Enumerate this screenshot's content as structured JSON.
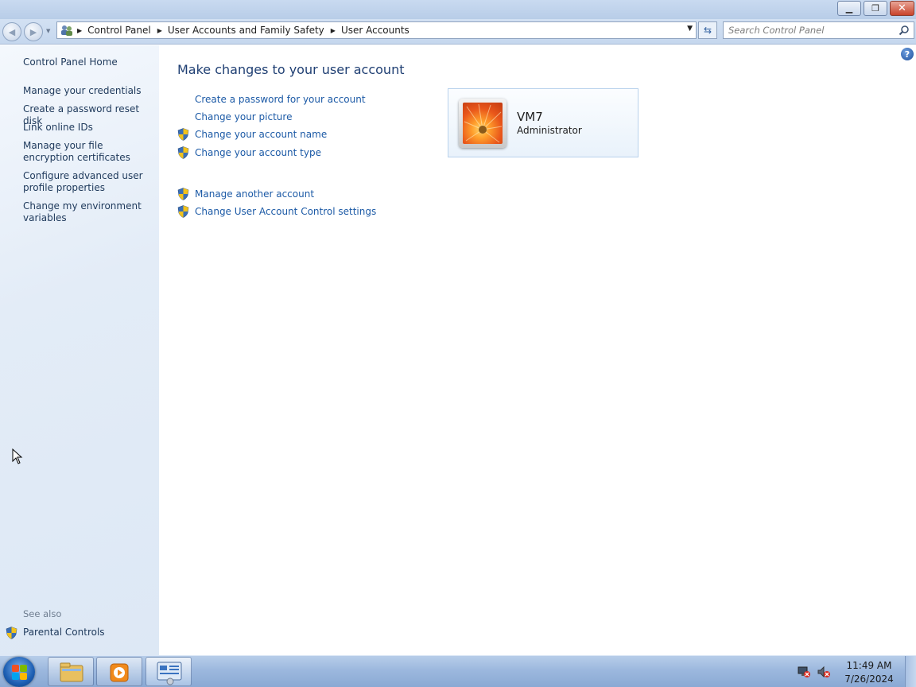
{
  "window": {
    "minimize_glyph": "▁",
    "restore_glyph": "❐",
    "close_glyph": "✕"
  },
  "address": {
    "crumbs": [
      "Control Panel",
      "User Accounts and Family Safety",
      "User Accounts"
    ],
    "search_placeholder": "Search Control Panel"
  },
  "sidebar": {
    "home": "Control Panel Home",
    "items": [
      {
        "label": "Manage your credentials"
      },
      {
        "label": "Create a password reset disk"
      },
      {
        "label": "Link online IDs"
      },
      {
        "label": "Manage your file encryption certificates"
      },
      {
        "label": "Configure advanced user profile properties"
      },
      {
        "label": "Change my environment variables"
      }
    ],
    "see_also": "See also",
    "parental_controls": "Parental Controls"
  },
  "main": {
    "title": "Make changes to your user account",
    "tasks": [
      {
        "label": "Create a password for your account",
        "shield": false
      },
      {
        "label": "Change your picture",
        "shield": false
      },
      {
        "label": "Change your account name",
        "shield": true
      },
      {
        "label": "Change your account type",
        "shield": true
      }
    ],
    "other_tasks": [
      {
        "label": "Manage another account",
        "shield": true
      },
      {
        "label": "Change User Account Control settings",
        "shield": true
      }
    ],
    "account": {
      "name": "VM7",
      "type": "Administrator"
    }
  },
  "taskbar": {
    "time": "11:49 AM",
    "date": "7/26/2024"
  },
  "colors": {
    "link": "#1c5aa6",
    "title": "#1f3f73",
    "sidebar_bg": "#dde8f5"
  }
}
